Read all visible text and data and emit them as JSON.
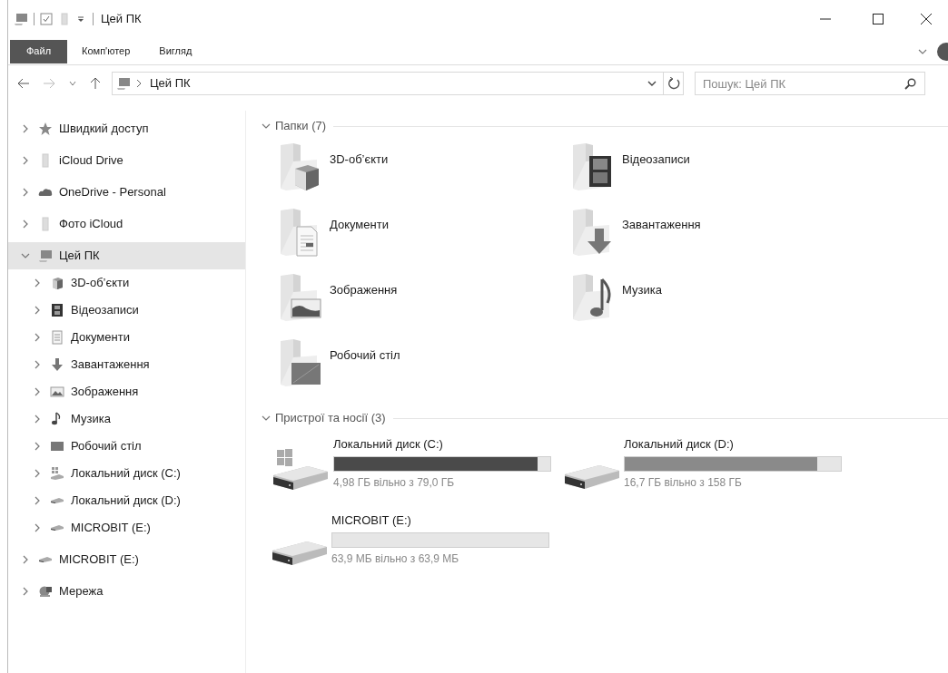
{
  "window": {
    "title": "Цей ПК"
  },
  "ribbon_tabs": [
    {
      "label": "Файл",
      "selected": true
    },
    {
      "label": "Комп'ютер",
      "selected": false
    },
    {
      "label": "Вигляд",
      "selected": false
    }
  ],
  "address": {
    "path": [
      "Цей ПК"
    ]
  },
  "search": {
    "placeholder": "Пошук: Цей ПК"
  },
  "sidebar": {
    "items": [
      {
        "label": "Швидкий доступ",
        "kind": "star",
        "expanded": false,
        "selected": false
      },
      {
        "label": "iCloud Drive",
        "kind": "folder",
        "expanded": false,
        "selected": false
      },
      {
        "label": "OneDrive - Personal",
        "kind": "cloud",
        "expanded": false,
        "selected": false
      },
      {
        "label": "Фото iCloud",
        "kind": "folder",
        "expanded": false,
        "selected": false
      },
      {
        "label": "Цей ПК",
        "kind": "pc",
        "expanded": true,
        "selected": true,
        "children": [
          {
            "label": "3D-об’єкти",
            "kind": "cube",
            "expanded": false,
            "selected": false
          },
          {
            "label": "Відеозаписи",
            "kind": "video",
            "expanded": false,
            "selected": false
          },
          {
            "label": "Документи",
            "kind": "documents",
            "expanded": false,
            "selected": false
          },
          {
            "label": "Завантаження",
            "kind": "downloads",
            "expanded": false,
            "selected": false
          },
          {
            "label": "Зображення",
            "kind": "pictures",
            "expanded": false,
            "selected": false
          },
          {
            "label": "Музика",
            "kind": "music",
            "expanded": false,
            "selected": false
          },
          {
            "label": "Робочий стіл",
            "kind": "desktop",
            "expanded": false,
            "selected": false
          },
          {
            "label": "Локальний диск (C:)",
            "kind": "system",
            "expanded": false,
            "selected": false
          },
          {
            "label": "Локальний диск (D:)",
            "kind": "drive",
            "expanded": false,
            "selected": false
          },
          {
            "label": "MICROBIT (E:)",
            "kind": "drive",
            "expanded": false,
            "selected": false
          }
        ]
      },
      {
        "label": "MICROBIT (E:)",
        "kind": "drive",
        "expanded": false,
        "selected": false
      },
      {
        "label": "Мережа",
        "kind": "network",
        "expanded": false,
        "selected": false
      }
    ]
  },
  "sections": [
    {
      "title": "Папки (7)",
      "kind": "folders",
      "expanded": true,
      "items": [
        {
          "name": "3D-об’єкти",
          "kind": "cube"
        },
        {
          "name": "Відеозаписи",
          "kind": "video"
        },
        {
          "name": "Документи",
          "kind": "documents"
        },
        {
          "name": "Завантаження",
          "kind": "downloads"
        },
        {
          "name": "Зображення",
          "kind": "pictures"
        },
        {
          "name": "Музика",
          "kind": "music"
        },
        {
          "name": "Робочий стіл",
          "kind": "desktop"
        }
      ]
    },
    {
      "title": "Пристрої та носії (3)",
      "kind": "drives",
      "expanded": true,
      "items": [
        {
          "name": "Локальний диск (C:)",
          "kind": "system",
          "level": 0.94,
          "color": "#4a4a4a",
          "free": "4,98 ГБ вільно з 79,0 ГБ"
        },
        {
          "name": "Локальний диск (D:)",
          "kind": "drive",
          "level": 0.89,
          "color": "#8a8a8a",
          "free": "16,7 ГБ вільно з 158 ГБ"
        },
        {
          "name": "MICROBIT (E:)",
          "kind": "drive",
          "level": 0,
          "free": "63,9 МБ вільно з 63,9 МБ"
        }
      ]
    }
  ]
}
